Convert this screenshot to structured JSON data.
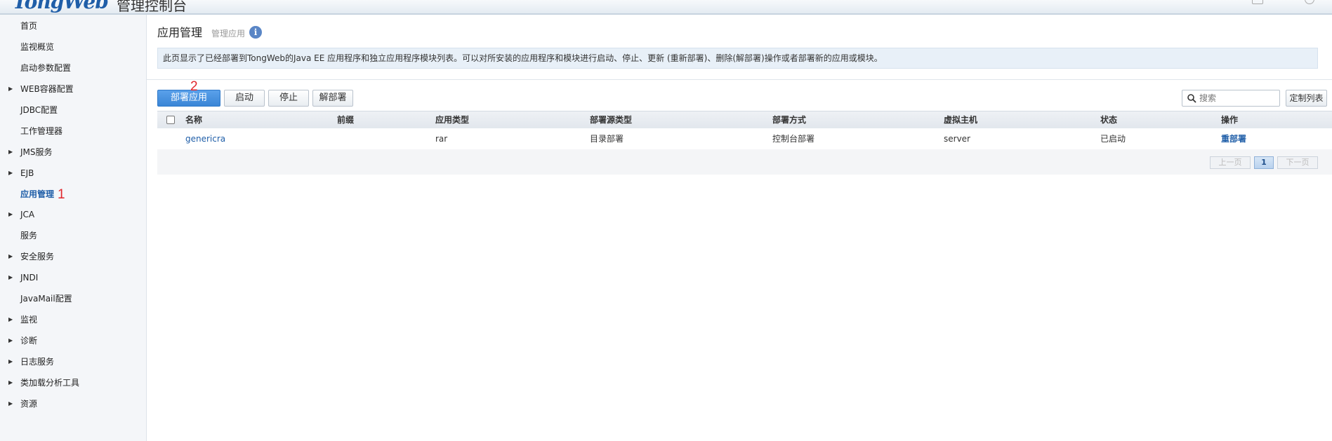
{
  "header": {
    "logo": "TongWeb",
    "title": "管理控制台"
  },
  "sidebar": {
    "items": [
      {
        "label": "首页",
        "expandable": false
      },
      {
        "label": "监视概览",
        "expandable": false
      },
      {
        "label": "启动参数配置",
        "expandable": false
      },
      {
        "label": "WEB容器配置",
        "expandable": true
      },
      {
        "label": "JDBC配置",
        "expandable": false
      },
      {
        "label": "工作管理器",
        "expandable": false
      },
      {
        "label": "JMS服务",
        "expandable": true
      },
      {
        "label": "EJB",
        "expandable": true
      },
      {
        "label": "应用管理",
        "expandable": false,
        "active": true
      },
      {
        "label": "JCA",
        "expandable": true
      },
      {
        "label": "服务",
        "expandable": false
      },
      {
        "label": "安全服务",
        "expandable": true
      },
      {
        "label": "JNDI",
        "expandable": true
      },
      {
        "label": "JavaMail配置",
        "expandable": false
      },
      {
        "label": "监视",
        "expandable": true
      },
      {
        "label": "诊断",
        "expandable": true
      },
      {
        "label": "日志服务",
        "expandable": true
      },
      {
        "label": "类加载分析工具",
        "expandable": true
      },
      {
        "label": "资源",
        "expandable": true
      }
    ]
  },
  "annotations": {
    "sidebar_marker": "1",
    "button_marker": "2"
  },
  "page": {
    "title": "应用管理",
    "subtitle": "管理应用",
    "info_icon": "i",
    "description": "此页显示了已经部署到TongWeb的Java EE 应用程序和独立应用程序模块列表。可以对所安装的应用程序和模块进行启动、停止、更新 (重新部署)、删除(解部署)操作或者部署新的应用或模块。"
  },
  "toolbar": {
    "deploy": "部署应用",
    "start": "启动",
    "stop": "停止",
    "undeploy": "解部署",
    "search_placeholder": "搜索",
    "customize": "定制列表"
  },
  "table": {
    "columns": [
      "名称",
      "前缀",
      "应用类型",
      "部署源类型",
      "部署方式",
      "虚拟主机",
      "状态",
      "操作"
    ],
    "rows": [
      {
        "name": "genericra",
        "prefix": "",
        "app_type": "rar",
        "source_type": "目录部署",
        "deploy_mode": "控制台部署",
        "virtual_host": "server",
        "status": "已启动",
        "action": "重部署"
      }
    ]
  },
  "pagination": {
    "prev": "上一页",
    "current": "1",
    "next": "下一页"
  },
  "colors": {
    "primary_button": "#3a85d6",
    "link": "#1f5ea8",
    "annotation": "#e0262c",
    "sidebar_bg": "#f4f6f9",
    "desc_bg": "#e8f0f8"
  }
}
